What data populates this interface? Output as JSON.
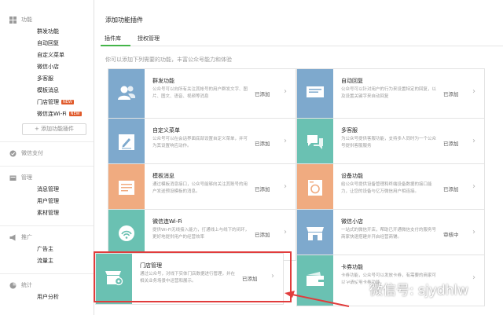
{
  "sidebar": {
    "features": {
      "title": "功能",
      "items": [
        {
          "label": "群发功能"
        },
        {
          "label": "自动回复"
        },
        {
          "label": "自定义菜单"
        },
        {
          "label": "微信小店"
        },
        {
          "label": "多客服"
        },
        {
          "label": "模板消息"
        },
        {
          "label": "门店管理",
          "badge": "NEW"
        },
        {
          "label": "微信连Wi-Fi",
          "badge": "NEW"
        }
      ],
      "add_button": "+ 添加功能插件"
    },
    "wechat_pay": {
      "title": "微信支付"
    },
    "manage": {
      "title": "管理",
      "items": [
        {
          "label": "消息管理"
        },
        {
          "label": "用户管理"
        },
        {
          "label": "素材管理"
        }
      ]
    },
    "promote": {
      "title": "推广",
      "items": [
        {
          "label": "广告主"
        },
        {
          "label": "流量主"
        }
      ]
    },
    "stats": {
      "title": "统计",
      "items": [
        {
          "label": "用户分析"
        }
      ]
    }
  },
  "main": {
    "title": "添加功能插件",
    "tabs": [
      {
        "label": "插件库"
      },
      {
        "label": "授权管理"
      }
    ],
    "description": "你可以添加下列需要的功能，丰富公众号能力和体验",
    "cards": [
      {
        "title": "群发功能",
        "body": "公众号可以向所有关注其帐号的用户群发文字、图片、图文、语音、视频等消息",
        "status": "已添加",
        "icon": "users-icon",
        "color": "#7ea9cd"
      },
      {
        "title": "自动回复",
        "body": "公众号可以针对用户的行为来设置特定的回复，以及设置关键字来自动回复",
        "status": "已添加",
        "icon": "message-icon",
        "color": "#7ea9cd"
      },
      {
        "title": "自定义菜单",
        "body": "公众号可以在会话界面底部设置自定义菜单，并可为其设置响应动作。",
        "status": "已添加",
        "icon": "edit-icon",
        "color": "#7ea9cd"
      },
      {
        "title": "多客服",
        "body": "为公众号提供客服功能，支持多人同时为一个公众号提供客服服务",
        "status": "已添加",
        "icon": "chat-icon",
        "color": "#6ac1b2"
      },
      {
        "title": "模板消息",
        "body": "通过模板消息接口，公众号能够向关注其账号的用户发送预设模板的消息。",
        "status": "已添加",
        "icon": "document-icon",
        "color": "#f0ab80"
      },
      {
        "title": "设备功能",
        "body": "给公众号提供设备管理和终端设备数据的接口能力，让您的设备与亿万微信用户相连接。",
        "status": "已添加",
        "icon": "washer-icon",
        "color": "#f0ab80"
      },
      {
        "title": "微信连Wi-Fi",
        "body": "提供Wi-Fi无线接入能力，打通线上与线下的闭环，更好地提供用户的经营效率",
        "status": "已添加",
        "icon": "wifi-icon",
        "color": "#6ac1b2"
      },
      {
        "title": "微信小店",
        "body": "一站式的微信开店，帮助已开通微信支付的服务号商家快速搭建并开启经营商铺。",
        "status": "审核中",
        "icon": "shop-icon",
        "color": "#7ea9cd"
      },
      {
        "title": "门店管理",
        "body": "通过公众号，对线下实体门店数据进行管理，并在相关业务场景中运营和展示。",
        "status": "已添加",
        "icon": "store-gear-icon",
        "color": "#6ac1b2"
      },
      {
        "title": "卡券功能",
        "body": "卡券功能，公众号可以发放卡券，有需要的商家可以申请使用卡券功能。",
        "status": "",
        "icon": "wallet-icon",
        "color": "#6ac1b2"
      }
    ]
  },
  "watermark": {
    "text": "微信号: sjydhlw"
  },
  "colors": {
    "accent": "#44b549",
    "highlight": "#e13c3c",
    "blue": "#7ea9cd",
    "teal": "#6ac1b2",
    "orange": "#f0ab80"
  }
}
